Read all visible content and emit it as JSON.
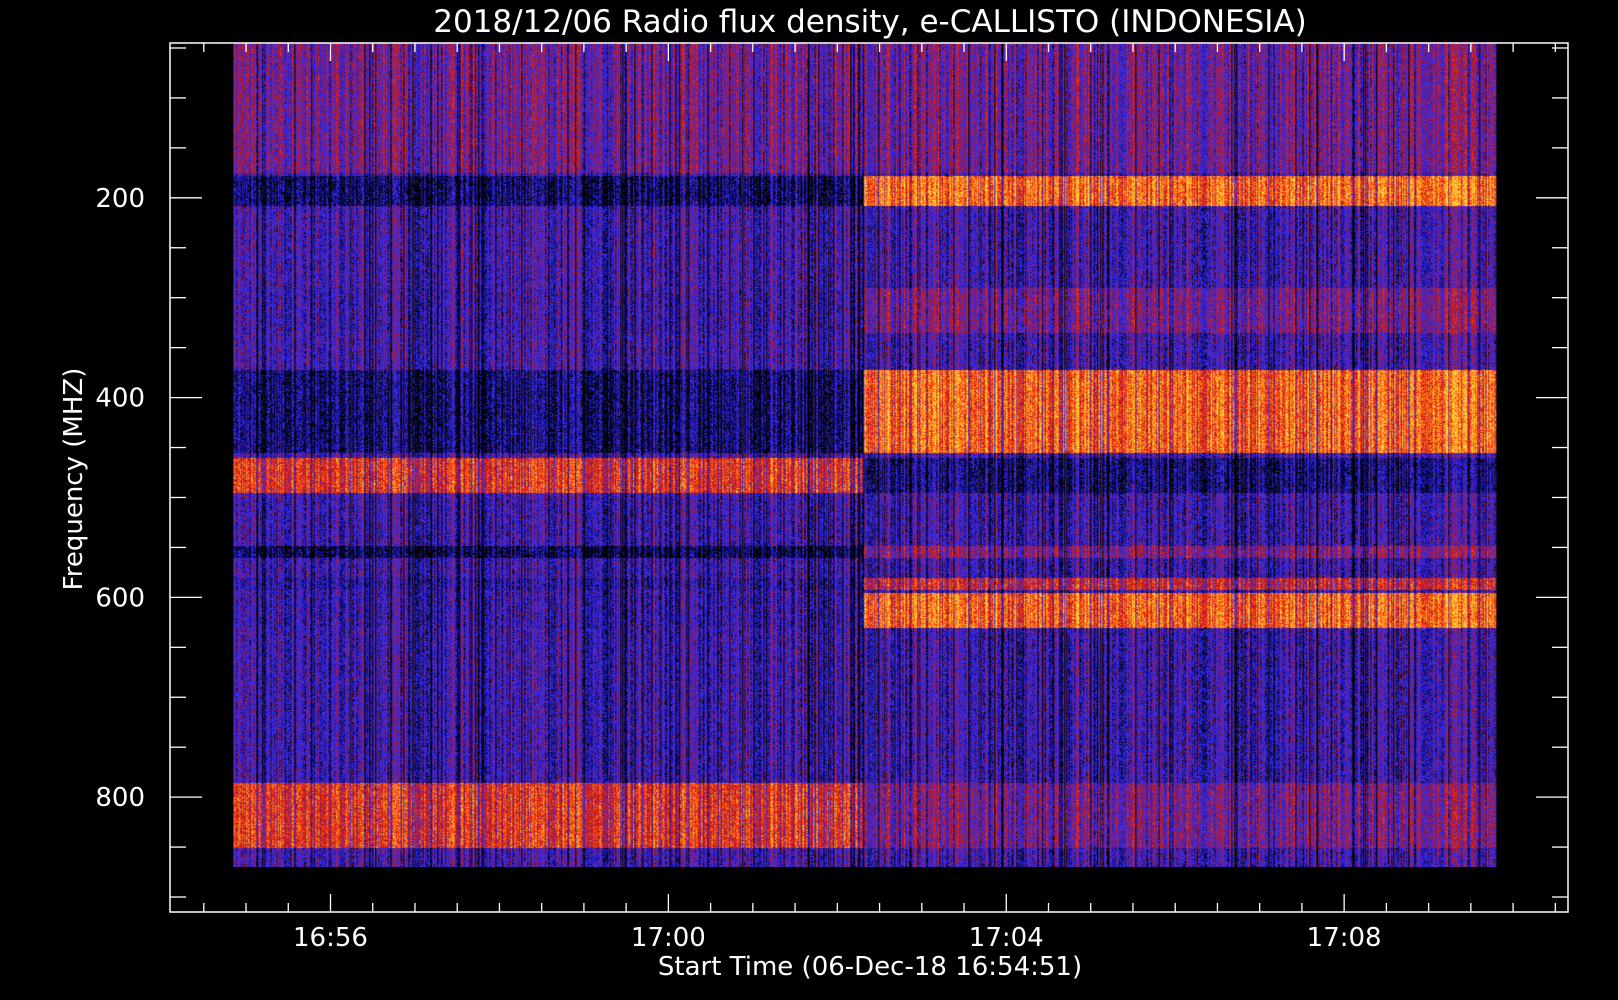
{
  "chart_data": {
    "type": "heatmap",
    "title": "2018/12/06  Radio flux density, e-CALLISTO (INDONESIA)",
    "xlabel": "Start Time (06-Dec-18 16:54:51)",
    "ylabel": "Frequency (MHZ)",
    "x_ticks": [
      "16:56",
      "17:00",
      "17:04",
      "17:08"
    ],
    "x_tick_minutes": [
      1.15,
      5.15,
      9.15,
      13.15
    ],
    "y_ticks": [
      "200",
      "400",
      "600",
      "800"
    ],
    "y_tick_values": [
      200,
      400,
      600,
      800
    ],
    "xlim_minutes": [
      -0.75,
      15.8
    ],
    "ylim_mhz": [
      45,
      915
    ],
    "data_extent": {
      "time_minutes": [
        0.0,
        14.95
      ],
      "freq_mhz": [
        45,
        870
      ]
    },
    "colormap": [
      "#000000",
      "#1a1acc",
      "#3a2ff0",
      "#7a1f7a",
      "#c01818",
      "#ff3010",
      "#ff9a20",
      "#ffe040"
    ],
    "grid": false,
    "background": "#000000",
    "event": {
      "onset_minutes": 7.45,
      "description_bands_mhz": [
        {
          "range": [
            180,
            205
          ],
          "before": "dark",
          "after": "bright"
        },
        {
          "range": [
            290,
            335
          ],
          "before": "background",
          "after": "dotted emission"
        },
        {
          "range": [
            375,
            455
          ],
          "before": "dark",
          "after": "bright"
        },
        {
          "range": [
            460,
            495
          ],
          "before": "bright",
          "after": "dark"
        },
        {
          "range": [
            550,
            590
          ],
          "before": "dark",
          "after": "moderate"
        },
        {
          "range": [
            595,
            630
          ],
          "before": "background",
          "after": "bright"
        },
        {
          "range": [
            790,
            850
          ],
          "before": "bright",
          "after": "mixed"
        }
      ]
    }
  }
}
